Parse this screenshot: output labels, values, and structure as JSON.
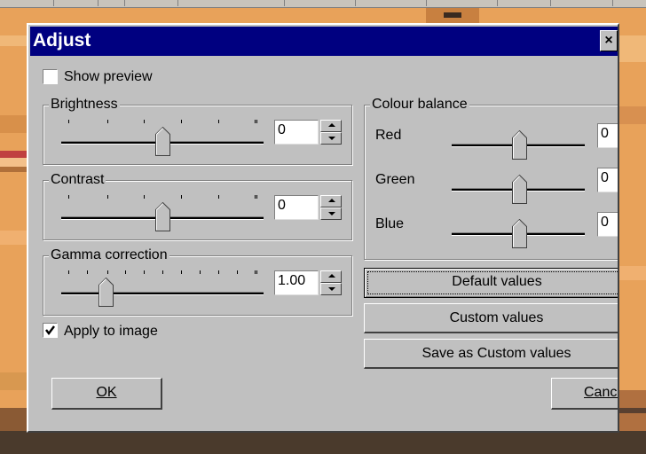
{
  "dialog": {
    "title": "Adjust",
    "close_label": "×",
    "show_preview": {
      "label": "Show preview",
      "checked": false
    },
    "apply_to_image": {
      "label": "Apply to image",
      "checked": true
    },
    "brightness": {
      "label": "Brightness",
      "value": "0"
    },
    "contrast": {
      "label": "Contrast",
      "value": "0"
    },
    "gamma": {
      "label": "Gamma correction",
      "value": "1.00"
    },
    "colour_balance": {
      "label": "Colour balance",
      "red": {
        "label": "Red",
        "value": "0"
      },
      "green": {
        "label": "Green",
        "value": "0"
      },
      "blue": {
        "label": "Blue",
        "value": "0"
      }
    },
    "buttons": {
      "default_values": "Default values",
      "custom_values": "Custom values",
      "save_custom": "Save as Custom values",
      "ok": "OK",
      "cancel": "Cancel"
    },
    "icons": {
      "close": "close-icon",
      "spin_up": "arrow-up-icon",
      "spin_down": "arrow-down-icon",
      "check": "check-icon"
    }
  }
}
